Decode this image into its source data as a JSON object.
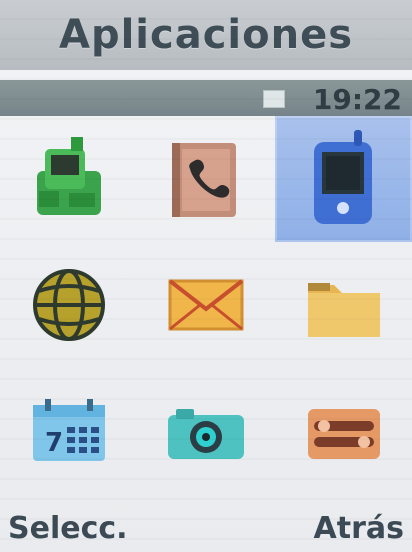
{
  "header": {
    "title": "Aplicaciones"
  },
  "status": {
    "time": "19:22"
  },
  "grid": {
    "selected_index": 2,
    "items": [
      {
        "icon": "game-icon"
      },
      {
        "icon": "phonebook-icon"
      },
      {
        "icon": "mobile-phone-icon"
      },
      {
        "icon": "globe-icon"
      },
      {
        "icon": "envelope-icon"
      },
      {
        "icon": "folder-icon"
      },
      {
        "icon": "calendar-icon"
      },
      {
        "icon": "camera-icon"
      },
      {
        "icon": "tools-icon"
      }
    ]
  },
  "softkeys": {
    "left": "Selecc.",
    "right": "Atrás"
  },
  "colors": {
    "title_text": "#3e4d56",
    "selection": "#9bb8ea",
    "status_bar": "#7f8c8f"
  }
}
